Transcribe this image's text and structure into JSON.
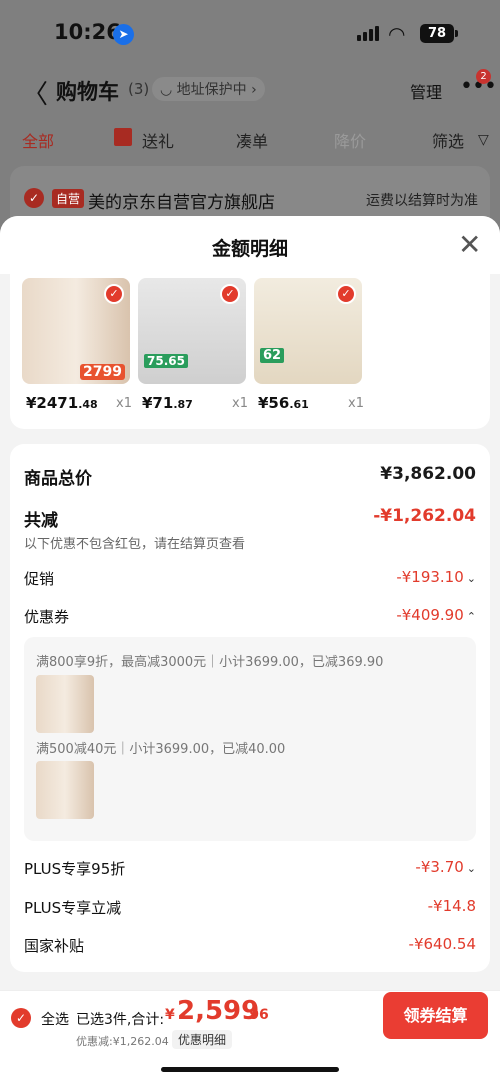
{
  "status_bar": {
    "time": "10:26",
    "battery": "78"
  },
  "nav": {
    "title": "购物车",
    "count": "(3)",
    "address_protect": "地址保护中",
    "manage": "管理",
    "more_badge": "2"
  },
  "tabs": [
    {
      "label": "全部"
    },
    {
      "label": "送礼"
    },
    {
      "label": "凑单"
    },
    {
      "label": "降价"
    },
    {
      "label": "筛选"
    }
  ],
  "store": {
    "tag": "自营",
    "name": "美的京东自营官方旗舰店",
    "shipping_note": "运费以结算时为准"
  },
  "sheet": {
    "title": "金额明细"
  },
  "products": [
    {
      "price_int": "¥2471",
      "price_dec": ".48",
      "qty": "x1",
      "tag_price": "2799",
      "color": "#e23b2c"
    },
    {
      "price_int": "¥71",
      "price_dec": ".87",
      "qty": "x1",
      "tag_price": "75.65",
      "color": "#2a9d5c"
    },
    {
      "price_int": "¥56",
      "price_dec": ".61",
      "qty": "x1",
      "tag_price": "62",
      "color": "#2a9d5c"
    }
  ],
  "summary": {
    "total_label": "商品总价",
    "total_value": "¥3,862.00",
    "reduce_label": "共减",
    "reduce_value": "-¥1,262.04",
    "reduce_note": "以下优惠不包含红包，请在结算页查看",
    "promo_label": "促销",
    "promo_value": "-¥193.10",
    "coupon_label": "优惠券",
    "coupon_value": "-¥409.90",
    "coupon_lines": [
      "满800享9折，最高减3000元｜小计3699.00，已减369.90",
      "满500减40元｜小计3699.00，已减40.00"
    ],
    "plus95_label": "PLUS专享95折",
    "plus95_value": "-¥3.70",
    "plus_instant_label": "PLUS专享立减",
    "plus_instant_value": "-¥14.8",
    "subsidy_label": "国家补贴",
    "subsidy_value": "-¥640.54"
  },
  "bottom": {
    "select_all": "全选",
    "selected": "已选3件,合计:",
    "currency": "¥",
    "total_int": "2,599",
    "total_dec": ".96",
    "discount_line": "优惠减:¥1,262.04",
    "detail_btn": "优惠明细",
    "checkout": "领券结算"
  },
  "colors": {
    "accent": "#e23b2c",
    "checkout": "#ea3d33"
  }
}
